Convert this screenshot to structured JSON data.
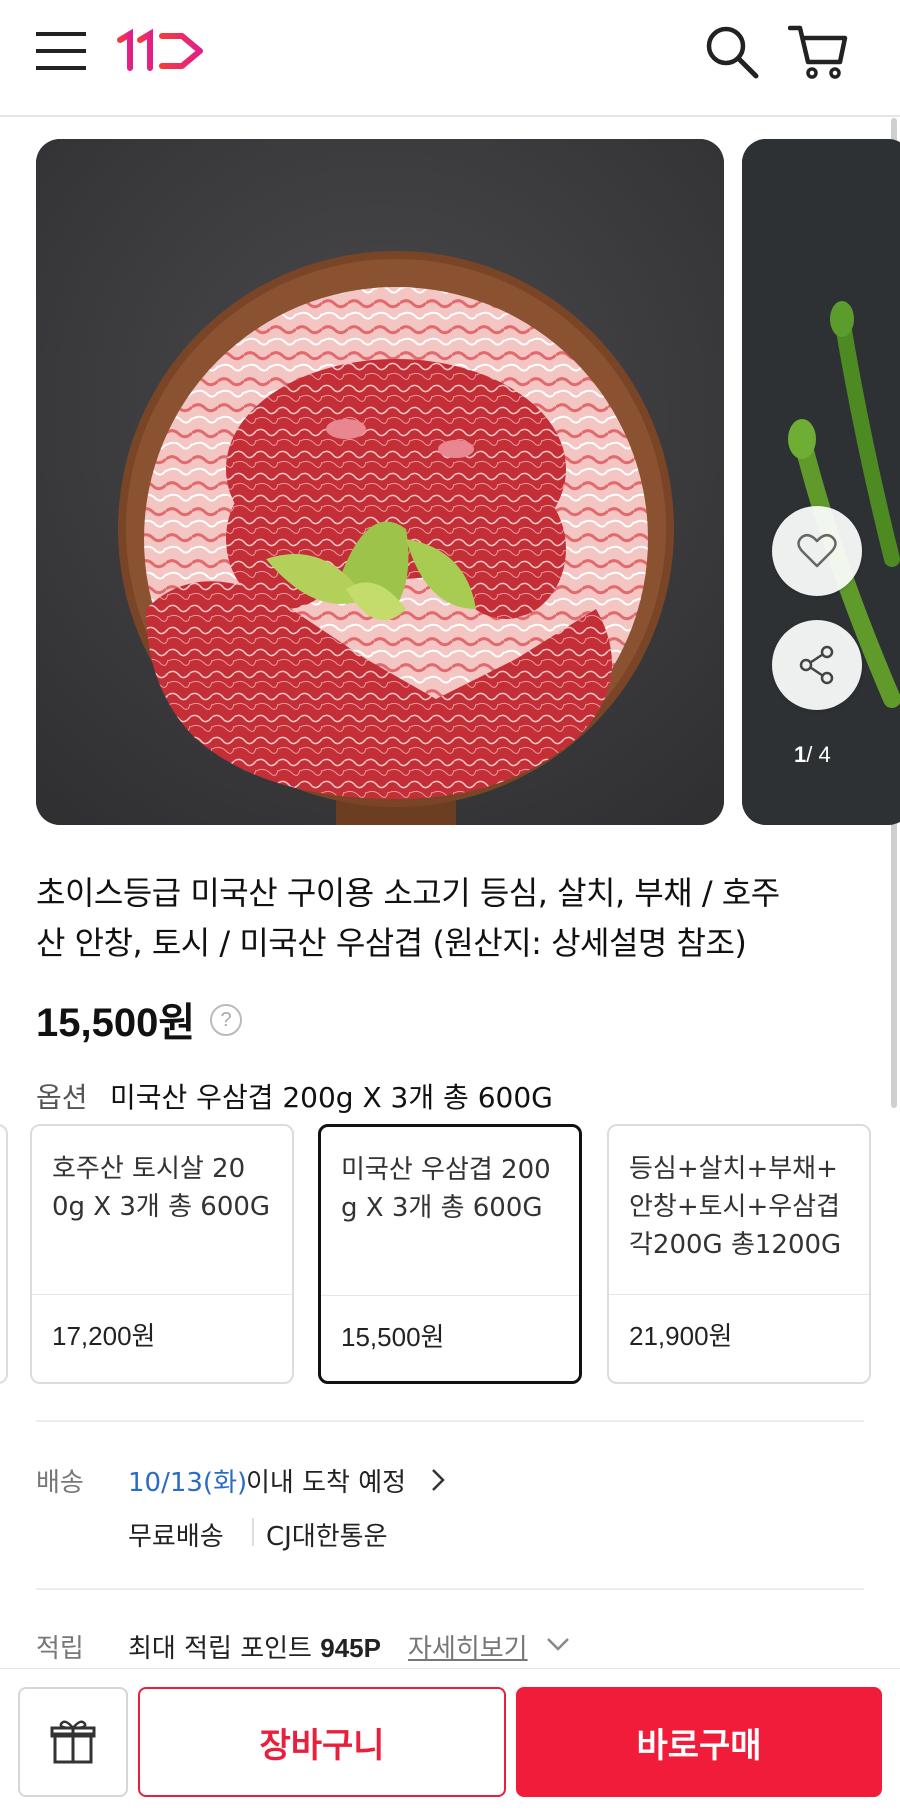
{
  "header": {
    "logo_text": "11",
    "menu_icon": "hamburger-menu-icon",
    "search_icon": "search-icon",
    "cart_icon": "cart-icon"
  },
  "gallery": {
    "counter_current": "1",
    "counter_total": "/ 4",
    "like_icon": "heart-icon",
    "share_icon": "share-icon"
  },
  "product": {
    "title_line1": "초이스등급 미국산 구이용 소고기 등심, 살치, 부채 / 호주",
    "title_line2": "산 안창, 토시 / 미국산 우삼겹 (원산지: 상세설명 참조)",
    "price": "15,500원",
    "price_help": "?"
  },
  "option": {
    "label": "옵션",
    "selected_value": "미국산 우삼겹 200g X 3개 총 600G",
    "cards": [
      {
        "name_line1": "호주산 토시살 20",
        "name_line2": "0g X 3개 총 600G",
        "name_line3": "",
        "price": "17,200원"
      },
      {
        "name_line1": "미국산 우삼겹 200",
        "name_line2": "g X 3개 총 600G",
        "name_line3": "",
        "price": "15,500원"
      },
      {
        "name_line1": "등심+살치+부채+",
        "name_line2": "안창+토시+우삼겹",
        "name_line3": "각200G 총1200G",
        "price": "21,900원"
      }
    ]
  },
  "delivery": {
    "label": "배송",
    "date": "10/13(화)",
    "text": "이내 도착 예정",
    "free": "무료배송",
    "carrier": "CJ대한통운"
  },
  "points": {
    "label": "적립",
    "text_prefix": "최대 적립 포인트 ",
    "amount": "945P",
    "more": "자세히보기"
  },
  "bottom": {
    "gift_icon": "gift-icon",
    "cart_label": "장바구니",
    "buy_label": "바로구매"
  },
  "colors": {
    "brand_red": "#f01c3a",
    "link_blue": "#2a6cc4"
  }
}
